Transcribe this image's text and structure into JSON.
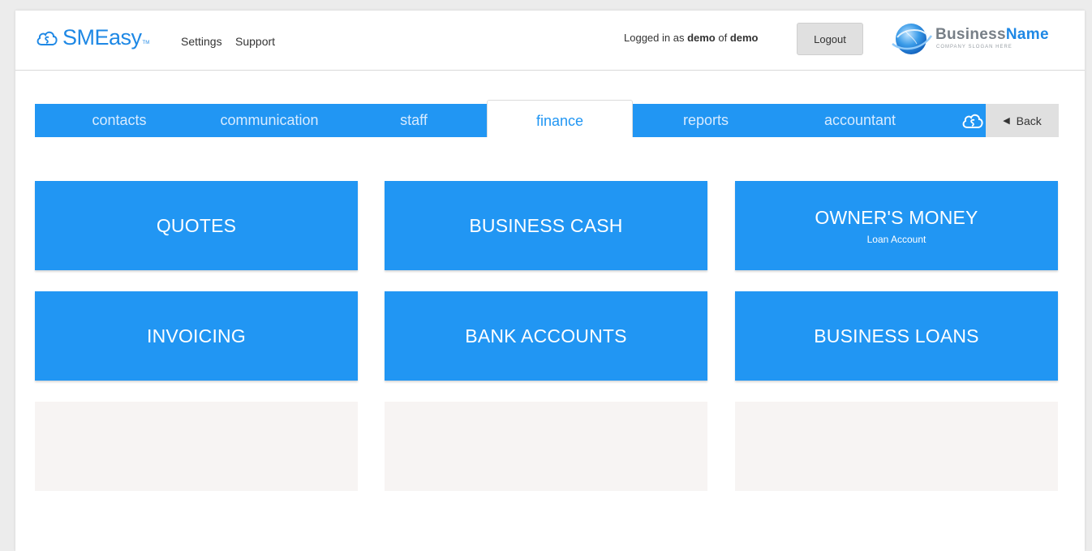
{
  "header": {
    "logo_text": "SMEasy",
    "logo_tm": "TM",
    "nav": [
      "Settings",
      "Support"
    ],
    "login_prefix": "Logged in as ",
    "login_user": "demo",
    "login_mid": " of ",
    "login_company": "demo",
    "logout_label": "Logout",
    "brand_part1": "Business",
    "brand_part2": "Name",
    "brand_slogan": "COMPANY SLOGAN HERE"
  },
  "tabs": [
    {
      "label": "contacts",
      "active": false
    },
    {
      "label": "communication",
      "active": false
    },
    {
      "label": "staff",
      "active": false
    },
    {
      "label": "finance",
      "active": true
    },
    {
      "label": "reports",
      "active": false
    },
    {
      "label": "accountant",
      "active": false
    }
  ],
  "back_label": "Back",
  "tiles": [
    {
      "title": "QUOTES",
      "subtitle": ""
    },
    {
      "title": "BUSINESS CASH",
      "subtitle": ""
    },
    {
      "title": "OWNER'S MONEY",
      "subtitle": "Loan Account"
    },
    {
      "title": "INVOICING",
      "subtitle": ""
    },
    {
      "title": "BANK ACCOUNTS",
      "subtitle": ""
    },
    {
      "title": "BUSINESS LOANS",
      "subtitle": ""
    }
  ],
  "colors": {
    "accent": "#2196f3",
    "tab_inactive_text": "#d7ebff",
    "empty_tile": "#f7f4f3"
  },
  "icons": [
    "smeasy-cloud-logo-icon",
    "business-globe-icon",
    "smeasy-cloud-icon",
    "back-arrow-icon"
  ]
}
